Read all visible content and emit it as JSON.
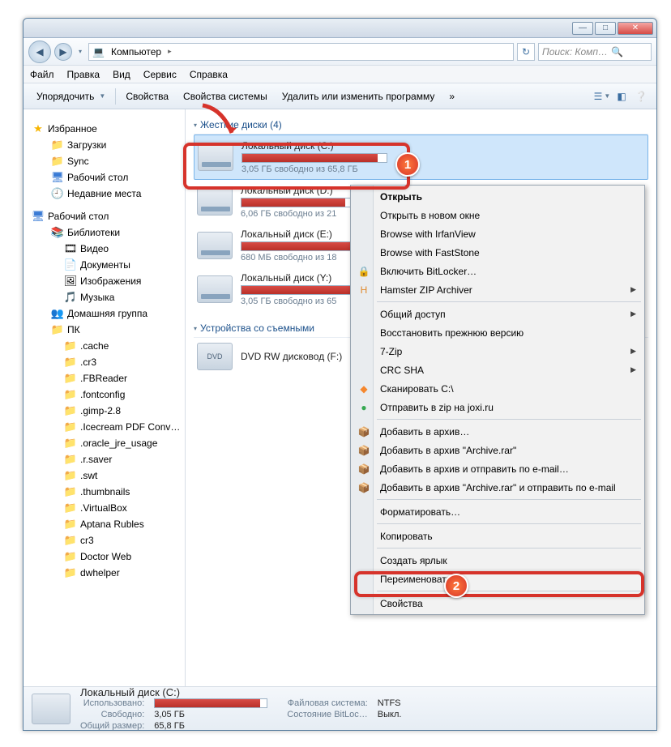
{
  "titlebar": {
    "min": "—",
    "max": "□",
    "close": "✕"
  },
  "nav": {
    "back": "◀",
    "fwd": "▶",
    "hist": "▾",
    "crumb_icon": "💻",
    "crumb": "Компьютер",
    "arrow": "▸",
    "refresh": "↻",
    "search_placeholder": "Поиск: Комп…",
    "search_icon": "🔍"
  },
  "menubar": [
    "Файл",
    "Правка",
    "Вид",
    "Сервис",
    "Справка"
  ],
  "toolbar": {
    "organize": "Упорядочить",
    "props": "Свойства",
    "sysprops": "Свойства системы",
    "remove": "Удалить или изменить программу",
    "more": "»"
  },
  "sidebar": {
    "favorites": {
      "label": "Избранное",
      "items": [
        "Загрузки",
        "Sync",
        "Рабочий стол",
        "Недавние места"
      ]
    },
    "desktop": {
      "label": "Рабочий стол",
      "libs": "Библиотеки",
      "libitems": [
        "Видео",
        "Документы",
        "Изображения",
        "Музыка"
      ],
      "homegroup": "Домашняя группа",
      "pc": "ПК",
      "pcfolders": [
        ".cache",
        ".cr3",
        ".FBReader",
        ".fontconfig",
        ".gimp-2.8",
        ".Icecream PDF Conv…",
        ".oracle_jre_usage",
        ".r.saver",
        ".swt",
        ".thumbnails",
        ".VirtualBox",
        "Aptana Rubles",
        "cr3",
        "Doctor Web",
        "dwhelper"
      ]
    }
  },
  "groups": {
    "hdd": {
      "label": "Жесткие диски (4)",
      "drives": [
        {
          "name": "Локальный диск (C:)",
          "free": "3,05 ГБ свободно из 65,8 ГБ",
          "fill": 94
        },
        {
          "name": "Локальный диск (D:)",
          "free": "6,06 ГБ свободно из 21",
          "fill": 72
        },
        {
          "name": "Локальный диск (E:)",
          "free": "680 МБ свободно из 18",
          "fill": 96
        },
        {
          "name": "Локальный диск (Y:)",
          "free": "3,05 ГБ свободно из 65",
          "fill": 94
        }
      ]
    },
    "removable": {
      "label": "Устройства со съемными",
      "dvd": "DVD RW дисковод (F:)"
    }
  },
  "ctx": {
    "open": "Открыть",
    "open_new": "Открыть в новом окне",
    "irfan": "Browse with IrfanView",
    "fast": "Browse with FastStone",
    "bitlocker": "Включить BitLocker…",
    "hamster": "Hamster ZIP Archiver",
    "share": "Общий доступ",
    "restore": "Восстановить прежнюю версию",
    "sevenzip": "7-Zip",
    "crc": "CRC SHA",
    "scan": "Сканировать C:\\",
    "joxi": "Отправить в zip на joxi.ru",
    "add_arch": "Добавить в архив…",
    "add_rar": "Добавить в архив \"Archive.rar\"",
    "add_mail": "Добавить в архив и отправить по e-mail…",
    "add_rar_mail": "Добавить в архив \"Archive.rar\" и отправить по e-mail",
    "format": "Форматировать…",
    "copy": "Копировать",
    "shortcut": "Создать ярлык",
    "rename": "Переименовать",
    "props": "Свойства"
  },
  "status": {
    "name": "Локальный диск (C:)",
    "used_l": "Использовано:",
    "used_fill": 94,
    "free_l": "Свободно:",
    "free_v": "3,05 ГБ",
    "total_l": "Общий размер:",
    "total_v": "65,8 ГБ",
    "fs_l": "Файловая система:",
    "fs_v": "NTFS",
    "bit_l": "Состояние BitLoc…",
    "bit_v": "Выкл."
  },
  "badges": {
    "one": "1",
    "two": "2"
  }
}
